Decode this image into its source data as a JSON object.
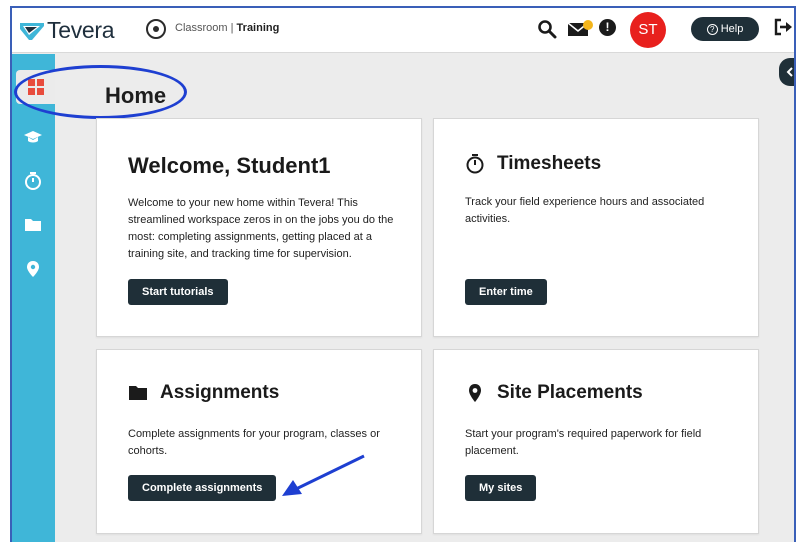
{
  "app": {
    "brand": "Tevera",
    "breadcrumb_context": "Classroom | ",
    "breadcrumb_current": "Training"
  },
  "header": {
    "avatar_initials": "ST",
    "help_label": "Help",
    "icons": [
      "search-icon",
      "mail-icon",
      "alert-icon",
      "logout-icon"
    ]
  },
  "sidebar": {
    "items": [
      {
        "name": "dashboard",
        "icon": "dashboard-grid-icon",
        "active": true
      },
      {
        "name": "courses",
        "icon": "graduation-cap-icon"
      },
      {
        "name": "timesheets",
        "icon": "stopwatch-icon"
      },
      {
        "name": "assignments",
        "icon": "folder-icon"
      },
      {
        "name": "placements",
        "icon": "map-pin-icon"
      }
    ],
    "color": "#3fb6d8"
  },
  "main": {
    "title": "Home",
    "cards": {
      "welcome": {
        "title": "Welcome, Student1",
        "description": "Welcome to your new home within Tevera! This streamlined workspace zeros in on the jobs you do the most: completing assignments, getting placed at a training site, and tracking time for supervision.",
        "button": "Start tutorials"
      },
      "timesheets": {
        "title": "Timesheets",
        "icon": "stopwatch-icon",
        "description": "Track your field experience hours and associated activities.",
        "button": "Enter time"
      },
      "assignments": {
        "title": "Assignments",
        "icon": "folder-icon",
        "description": "Complete assignments for your program, classes or cohorts.",
        "button": "Complete assignments"
      },
      "placements": {
        "title": "Site Placements",
        "icon": "map-pin-icon",
        "description": "Start your program's required paperwork for field placement.",
        "button": "My sites"
      }
    }
  },
  "colors": {
    "accent_dark": "#1f2f38",
    "avatar_red": "#e8201d",
    "annotation_blue": "#1e3fd1"
  }
}
